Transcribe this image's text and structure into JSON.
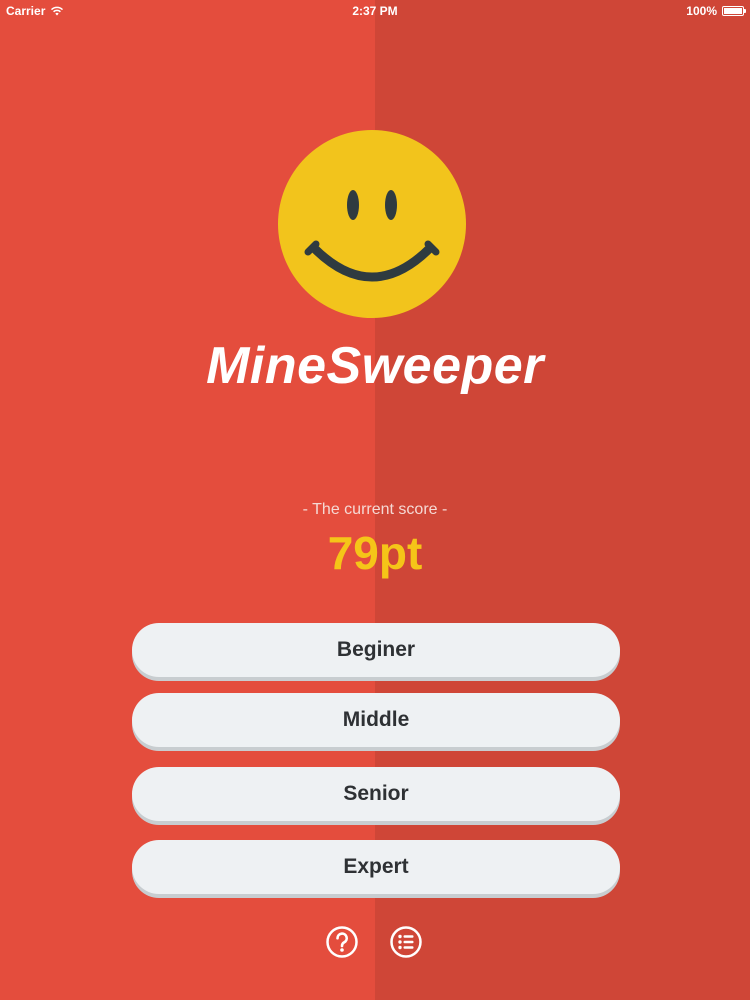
{
  "status_bar": {
    "carrier": "Carrier",
    "time": "2:37 PM",
    "battery": "100%"
  },
  "logo": {
    "icon": "smiley-face-icon",
    "face_color": "#F2C41C",
    "feature_color": "#2F3B40"
  },
  "title": "MineSweeper",
  "score": {
    "label": "- The current score -",
    "value": "79pt"
  },
  "difficulty_buttons": [
    {
      "label": "Beginer"
    },
    {
      "label": "Middle"
    },
    {
      "label": "Senior"
    },
    {
      "label": "Expert"
    }
  ],
  "bottom_icons": [
    {
      "icon": "help-icon"
    },
    {
      "icon": "list-icon"
    }
  ],
  "colors": {
    "background_left": "#E44D3D",
    "background_right": "#CF4637",
    "score_value": "#F5C518",
    "button_bg": "#EEF1F3",
    "button_text": "#2E3134"
  }
}
